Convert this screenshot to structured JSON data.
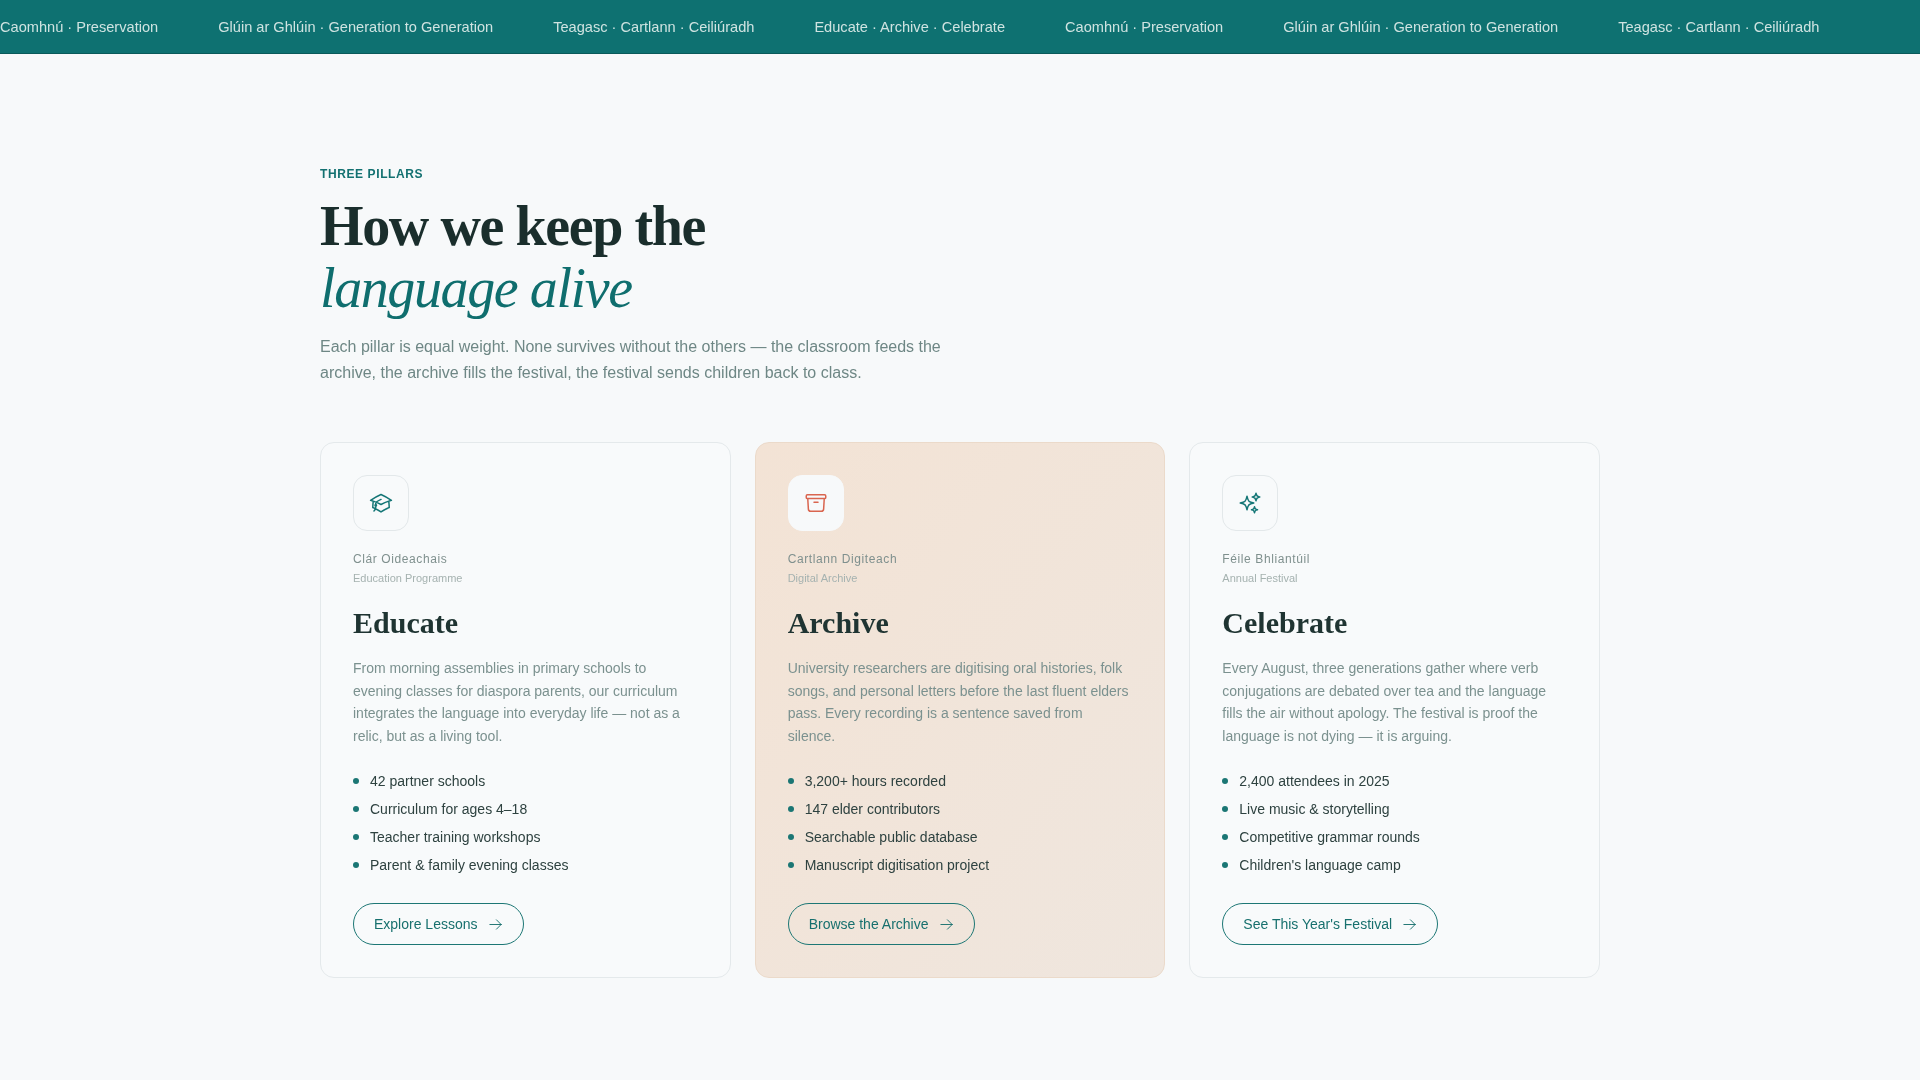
{
  "ticker": {
    "items": [
      "Caomhnú · Preservation",
      "Glúin ar Ghlúin · Generation to Generation",
      "Teagasc · Cartlann · Ceiliúradh",
      "Educate · Archive · Celebrate",
      "Caomhnú · Preservation",
      "Glúin ar Ghlúin · Generation to Generation",
      "Teagasc · Cartlann · Ceiliúradh"
    ]
  },
  "section": {
    "eyebrow": "THREE PILLARS",
    "heading": {
      "line_1": "How we keep the",
      "line_2": "language alive"
    },
    "intro": "Each pillar is equal weight. None survives without the others — the classroom feeds the archive, the archive fills the festival, the festival sends children back to class."
  },
  "pillars": [
    {
      "featured": false,
      "irish_name": "Clár Oideachais",
      "english_name": "Education Programme",
      "title": "Educate",
      "description": "From morning assemblies in primary schools to evening classes for diaspora parents, our curriculum integrates the language into everyday life — not as a relic, but as a living tool.",
      "highlights": [
        "42 partner schools",
        "Curriculum for ages 4–18",
        "Teacher training workshops",
        "Parent & family evening classes"
      ],
      "button": "Explore Lessons"
    },
    {
      "featured": true,
      "irish_name": "Cartlann Digiteach",
      "english_name": "Digital Archive",
      "title": "Archive",
      "description": "University researchers are digitising oral histories, folk songs, and personal letters before the last fluent elders pass. Every recording is a sentence saved from silence.",
      "highlights": [
        "3,200+ hours recorded",
        "147 elder contributors",
        "Searchable public database",
        "Manuscript digitisation project"
      ],
      "button": "Browse the Archive"
    },
    {
      "featured": false,
      "irish_name": "Féile Bhliantúil",
      "english_name": "Annual Festival",
      "title": "Celebrate",
      "description": "Every August, three generations gather where verb conjugations are debated over tea and the language fills the air without apology. The festival is proof the language is not dying — it is arguing.",
      "highlights": [
        "2,400 attendees in 2025",
        "Live music & storytelling",
        "Competitive grammar rounds",
        "Children's language camp"
      ],
      "button": "See This Year's Festival"
    }
  ]
}
